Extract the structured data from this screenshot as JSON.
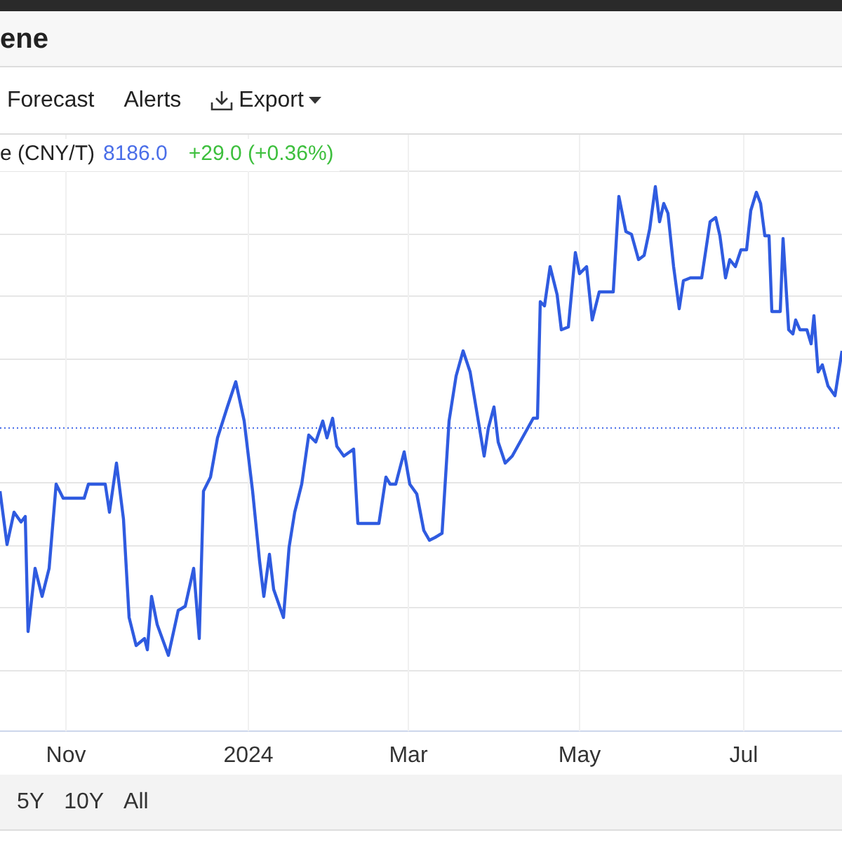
{
  "header": {
    "title": "ene"
  },
  "toolbar": [
    {
      "label": "Forecast",
      "kind": "plain"
    },
    {
      "label": "Alerts",
      "kind": "plain"
    },
    {
      "label": "Export",
      "kind": "dropdown"
    }
  ],
  "legend": {
    "series": "e (CNY/T)",
    "price": "8186.0",
    "change": "+29.0 (+0.36%)"
  },
  "x_axis_labels": [
    "Nov",
    "2024",
    "Mar",
    "May",
    "Jul"
  ],
  "ranges": [
    {
      "label": "5Y",
      "selected": false
    },
    {
      "label": "10Y",
      "selected": false
    },
    {
      "label": "All",
      "selected": false
    }
  ]
}
